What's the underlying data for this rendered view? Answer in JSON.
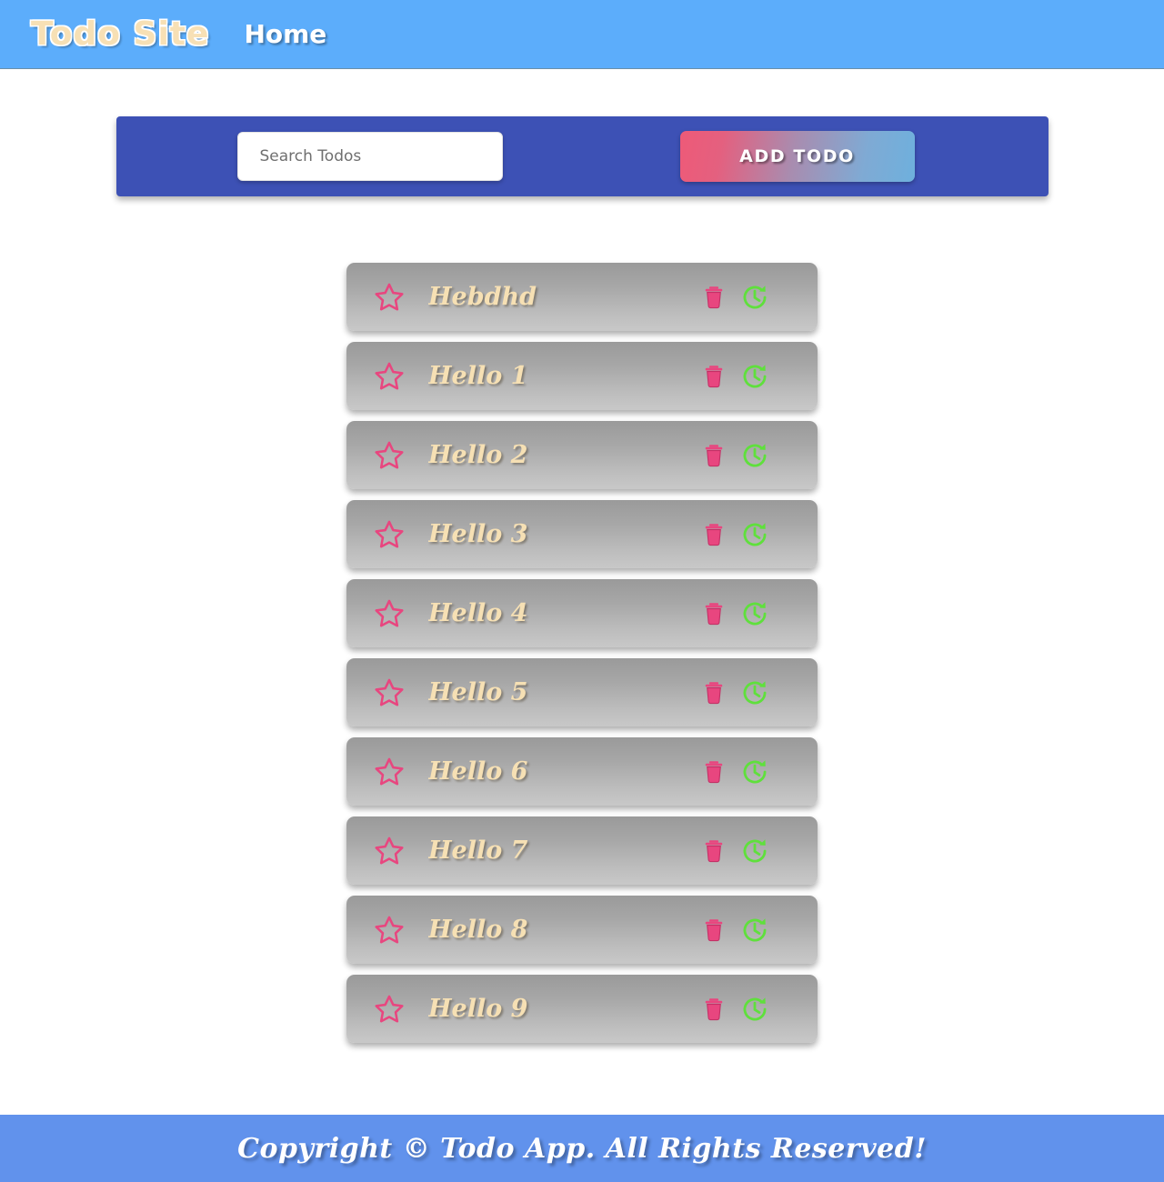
{
  "header": {
    "brand": "Todo Site",
    "nav": [
      {
        "label": "Home",
        "name": "nav-link-home"
      }
    ],
    "background_color": "#5CADFB",
    "brand_color": "#F7E0B5"
  },
  "toolbar": {
    "background_color": "#3D51B5",
    "search": {
      "placeholder": "Search Todos",
      "value": ""
    },
    "add_button": {
      "label": "ADD TODO",
      "gradient_from": "#EE5A78",
      "gradient_to": "#6EB0DD"
    }
  },
  "todos": {
    "item_icons": {
      "favorite": "star-icon",
      "delete": "trash-icon",
      "restore": "clock-restore-icon"
    },
    "colors": {
      "text": "#F6E0B4",
      "star": "#E8467F",
      "trash": "#E8467F",
      "restore": "#5FE03C",
      "row_gradient_from": "#9a9a9a",
      "row_gradient_to": "#c8c8c8"
    },
    "items": [
      {
        "title": "Hebdhd"
      },
      {
        "title": "Hello 1"
      },
      {
        "title": "Hello 2"
      },
      {
        "title": "Hello 3"
      },
      {
        "title": "Hello 4"
      },
      {
        "title": "Hello 5"
      },
      {
        "title": "Hello 6"
      },
      {
        "title": "Hello 7"
      },
      {
        "title": "Hello 8"
      },
      {
        "title": "Hello 9"
      }
    ]
  },
  "footer": {
    "text": "Copyright © Todo App. All Rights Reserved!",
    "background_color": "#6192EC"
  }
}
